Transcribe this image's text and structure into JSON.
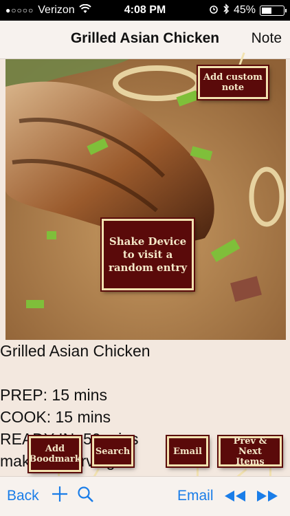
{
  "status_bar": {
    "carrier": "Verizon",
    "time": "4:08 PM",
    "battery": "45%",
    "battery_level": 0.45
  },
  "nav": {
    "title": "Grilled Asian Chicken",
    "note_label": "Note"
  },
  "recipe": {
    "title": "Grilled Asian Chicken",
    "prep": "PREP: 15 mins",
    "cook": "COOK: 15 mins",
    "ready": "READY IN: 50 mins",
    "makes": "makes 4 servings"
  },
  "tooltips": {
    "note": "Add custom note",
    "shake": "Shake Device to visit a random entry",
    "bookmark": "Add Boodmark",
    "search": "Search",
    "email": "Email",
    "prevnext": "Prev & Next Items"
  },
  "toolbar": {
    "back_label": "Back",
    "email_label": "Email"
  },
  "colors": {
    "ios_blue": "#1a7de8",
    "tooltip_bg": "#5a0a0a",
    "tooltip_border": "#f2e2b0",
    "page_bg": "#f3e8df"
  },
  "icons": [
    "wifi-icon",
    "alarm-icon",
    "bluetooth-icon",
    "battery-icon",
    "add-icon",
    "search-icon",
    "prev-icon",
    "next-icon"
  ]
}
